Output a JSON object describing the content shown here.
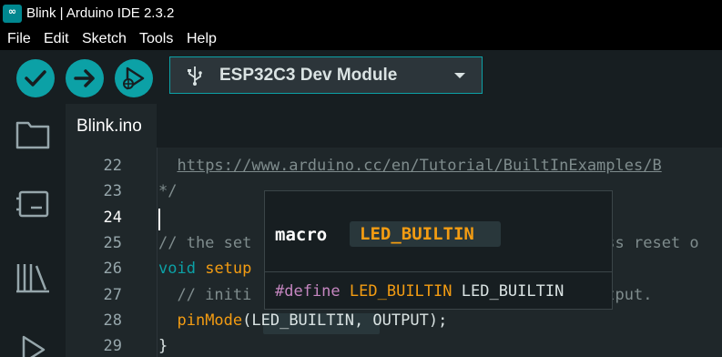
{
  "window": {
    "title": "Blink | Arduino IDE 2.3.2",
    "app_icon_glyph": "∞"
  },
  "menu": [
    {
      "label": "File"
    },
    {
      "label": "Edit"
    },
    {
      "label": "Sketch"
    },
    {
      "label": "Tools"
    },
    {
      "label": "Help"
    }
  ],
  "toolbar": {
    "verify_icon": "checkmark-icon",
    "upload_icon": "arrow-right-icon",
    "debug_icon": "debug-icon",
    "board_icon": "usb-icon",
    "board_name": "ESP32C3 Dev Module"
  },
  "sidebar": [
    {
      "icon": "folder-icon"
    },
    {
      "icon": "board-manager-icon"
    },
    {
      "icon": "library-icon"
    },
    {
      "icon": "debug-icon"
    }
  ],
  "tabs": [
    {
      "label": "Blink.ino",
      "active": true
    }
  ],
  "editor": {
    "active_line": "24",
    "lines": [
      {
        "num": "22",
        "parts": [
          {
            "text": "  ",
            "cls": "comment"
          },
          {
            "text": "https://www.arduino.cc/en/Tutorial/BuiltInExamples/B",
            "cls": "link"
          }
        ]
      },
      {
        "num": "23",
        "parts": [
          {
            "text": "*/",
            "cls": "comment"
          }
        ]
      },
      {
        "num": "24",
        "parts": []
      },
      {
        "num": "25",
        "parts": [
          {
            "text": "// the set",
            "cls": "comment"
          },
          {
            "text": "                                     ess reset o",
            "cls": "comment"
          }
        ]
      },
      {
        "num": "26",
        "parts": [
          {
            "text": "void",
            "cls": "kw"
          },
          {
            "text": " ",
            "cls": "ident"
          },
          {
            "text": "setup",
            "cls": "fn"
          }
        ]
      },
      {
        "num": "27",
        "parts": [
          {
            "text": "  // initi",
            "cls": "comment"
          },
          {
            "text": "                                 an output.",
            "cls": "comment"
          }
        ]
      },
      {
        "num": "28",
        "parts": [
          {
            "text": "  ",
            "cls": "ident"
          },
          {
            "text": "pinMode",
            "cls": "fn"
          },
          {
            "text": "(LED_BUILTIN, OUTPUT);",
            "cls": "ident"
          }
        ]
      },
      {
        "num": "29",
        "parts": [
          {
            "text": "}",
            "cls": "ident"
          }
        ]
      }
    ]
  },
  "hover": {
    "kind": "macro",
    "name": "LED_BUILTIN",
    "define_keyword": "#define",
    "define_name": "LED_BUILTIN",
    "define_value": "LED_BUILTIN"
  },
  "colors": {
    "accent": "#0ca1a6",
    "background": "#171e21",
    "editor_background": "#1f272a",
    "function": "#f39c12",
    "comment": "#7f8c8d"
  }
}
